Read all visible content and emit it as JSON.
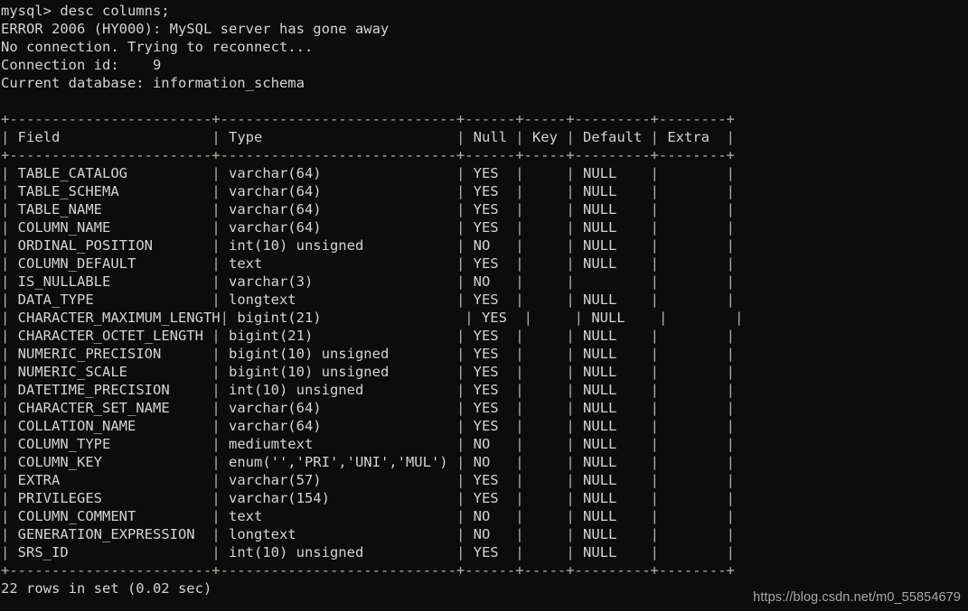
{
  "terminal": {
    "prompt_line": "mysql> desc columns;",
    "messages": [
      "ERROR 2006 (HY000): MySQL server has gone away",
      "No connection. Trying to reconnect...",
      "Connection id:    9",
      "Current database: information_schema"
    ],
    "footer": "22 rows in set (0.02 sec)",
    "colors": {
      "background": "#0c0c0c",
      "text": "#d3d3d3",
      "rule": "#b9b0a6"
    }
  },
  "table": {
    "columns": [
      {
        "header": "Field",
        "width": 24
      },
      {
        "header": "Type",
        "width": 28
      },
      {
        "header": "Null",
        "width": 6
      },
      {
        "header": "Key",
        "width": 5
      },
      {
        "header": "Default",
        "width": 9
      },
      {
        "header": "Extra",
        "width": 8
      }
    ],
    "rows": [
      [
        "TABLE_CATALOG",
        "varchar(64)",
        "YES",
        "",
        "NULL",
        ""
      ],
      [
        "TABLE_SCHEMA",
        "varchar(64)",
        "YES",
        "",
        "NULL",
        ""
      ],
      [
        "TABLE_NAME",
        "varchar(64)",
        "YES",
        "",
        "NULL",
        ""
      ],
      [
        "COLUMN_NAME",
        "varchar(64)",
        "YES",
        "",
        "NULL",
        ""
      ],
      [
        "ORDINAL_POSITION",
        "int(10) unsigned",
        "NO",
        "",
        "NULL",
        ""
      ],
      [
        "COLUMN_DEFAULT",
        "text",
        "YES",
        "",
        "NULL",
        ""
      ],
      [
        "IS_NULLABLE",
        "varchar(3)",
        "NO",
        "",
        "",
        ""
      ],
      [
        "DATA_TYPE",
        "longtext",
        "YES",
        "",
        "NULL",
        ""
      ],
      [
        "CHARACTER_MAXIMUM_LENGTH",
        "bigint(21)",
        "YES",
        "",
        "NULL",
        ""
      ],
      [
        "CHARACTER_OCTET_LENGTH",
        "bigint(21)",
        "YES",
        "",
        "NULL",
        ""
      ],
      [
        "NUMERIC_PRECISION",
        "bigint(10) unsigned",
        "YES",
        "",
        "NULL",
        ""
      ],
      [
        "NUMERIC_SCALE",
        "bigint(10) unsigned",
        "YES",
        "",
        "NULL",
        ""
      ],
      [
        "DATETIME_PRECISION",
        "int(10) unsigned",
        "YES",
        "",
        "NULL",
        ""
      ],
      [
        "CHARACTER_SET_NAME",
        "varchar(64)",
        "YES",
        "",
        "NULL",
        ""
      ],
      [
        "COLLATION_NAME",
        "varchar(64)",
        "YES",
        "",
        "NULL",
        ""
      ],
      [
        "COLUMN_TYPE",
        "mediumtext",
        "NO",
        "",
        "NULL",
        ""
      ],
      [
        "COLUMN_KEY",
        "enum('','PRI','UNI','MUL')",
        "NO",
        "",
        "NULL",
        ""
      ],
      [
        "EXTRA",
        "varchar(57)",
        "YES",
        "",
        "NULL",
        ""
      ],
      [
        "PRIVILEGES",
        "varchar(154)",
        "YES",
        "",
        "NULL",
        ""
      ],
      [
        "COLUMN_COMMENT",
        "text",
        "NO",
        "",
        "NULL",
        ""
      ],
      [
        "GENERATION_EXPRESSION",
        "longtext",
        "NO",
        "",
        "NULL",
        ""
      ],
      [
        "SRS_ID",
        "int(10) unsigned",
        "YES",
        "",
        "NULL",
        ""
      ]
    ]
  },
  "watermark": {
    "text": "https://blog.csdn.net/m0_55854679"
  }
}
